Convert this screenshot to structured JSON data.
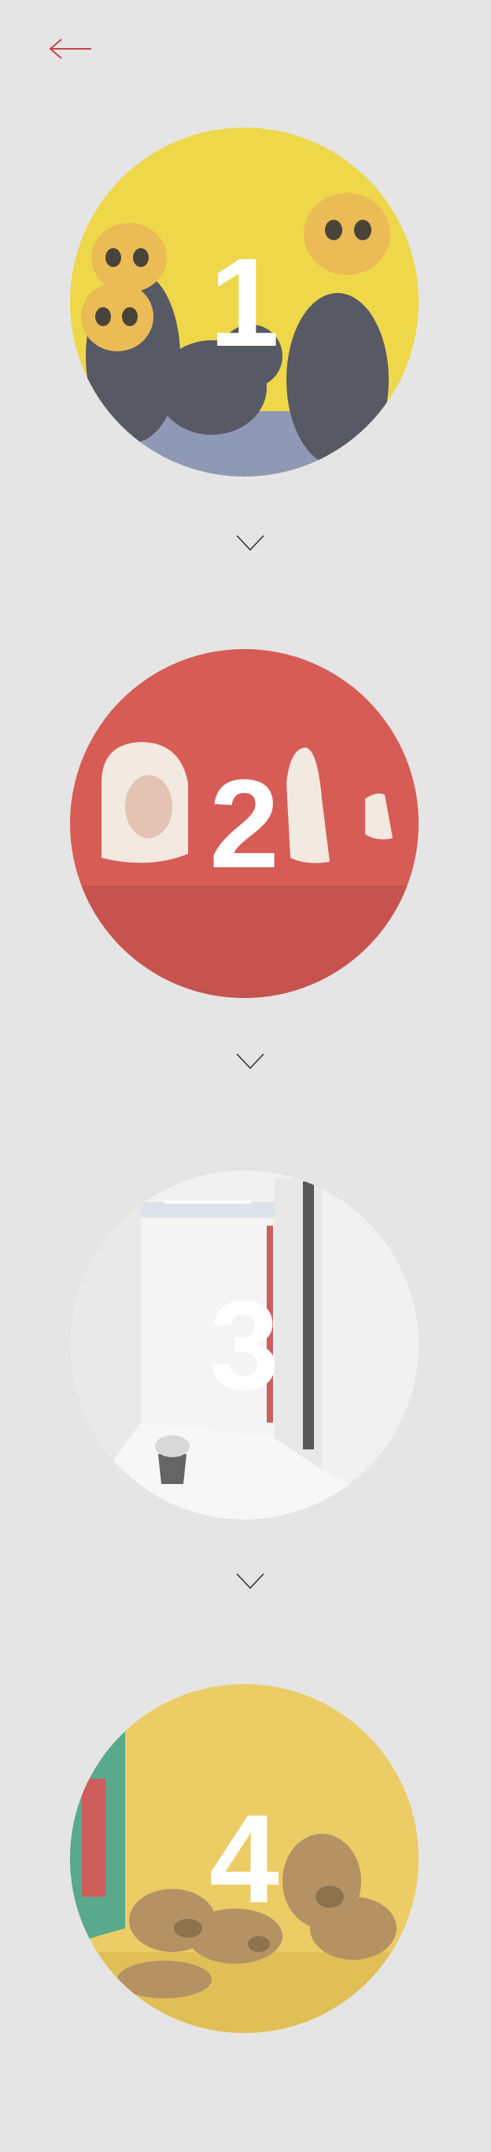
{
  "nav": {
    "back_icon": "arrow-left-icon",
    "accent_color": "#c8424a"
  },
  "rooms": [
    {
      "number": "1",
      "theme_color": "#ecd02a",
      "subject": "golden-skull-figures"
    },
    {
      "number": "2",
      "theme_color": "#cf4038",
      "subject": "white-ceramic-forms"
    },
    {
      "number": "3",
      "theme_color": "#efefef",
      "subject": "white-gallery-room-with-bucket"
    },
    {
      "number": "4",
      "theme_color": "#e9c349",
      "subject": "bronze-figures-on-yellow-floor"
    }
  ],
  "dividers": {
    "icon": "chevron-down-icon",
    "color": "#333333"
  }
}
